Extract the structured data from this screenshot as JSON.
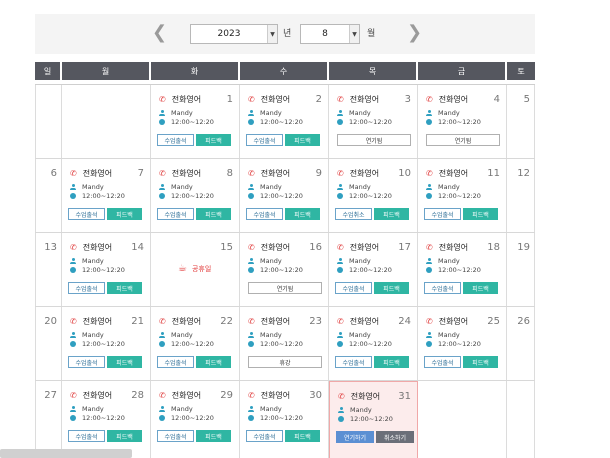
{
  "nav": {
    "year": "2023",
    "year_unit": "년",
    "month": "8",
    "month_unit": "월",
    "prev_icon": "chevron-left-icon",
    "next_icon": "chevron-right-icon"
  },
  "weekdays": [
    "일",
    "월",
    "화",
    "수",
    "목",
    "금",
    "토"
  ],
  "class": {
    "title": "전화영어",
    "user": "Mandy",
    "time": "12:00~12:20"
  },
  "labels": {
    "attend": "수업출석",
    "feedback": "피드백",
    "postponed": "연기됨",
    "postpone": "연기하기",
    "cancel": "취소하기",
    "cancel_done": "수업취소",
    "closed": "휴강",
    "holiday": "공휴일"
  },
  "colors": {
    "header": "#55575f",
    "teal": "#2fb6a3",
    "today_bg": "#fcecec",
    "phone": "#e04040",
    "holiday": "#e23b3b"
  },
  "weeks": [
    [
      {
        "day": "",
        "type": "empty"
      },
      {
        "day": "",
        "type": "empty"
      },
      {
        "day": "1",
        "type": "class",
        "action": "attend_feedback"
      },
      {
        "day": "2",
        "type": "class",
        "action": "attend_feedback"
      },
      {
        "day": "3",
        "type": "class",
        "action": "postponed"
      },
      {
        "day": "4",
        "type": "class",
        "action": "postponed"
      },
      {
        "day": "5",
        "type": "plain"
      }
    ],
    [
      {
        "day": "6",
        "type": "plain"
      },
      {
        "day": "7",
        "type": "class",
        "action": "attend_feedback"
      },
      {
        "day": "8",
        "type": "class",
        "action": "attend_feedback"
      },
      {
        "day": "9",
        "type": "class",
        "action": "attend_feedback"
      },
      {
        "day": "10",
        "type": "class",
        "action": "cancel_feedback"
      },
      {
        "day": "11",
        "type": "class",
        "action": "attend_feedback"
      },
      {
        "day": "12",
        "type": "plain"
      }
    ],
    [
      {
        "day": "13",
        "type": "plain"
      },
      {
        "day": "14",
        "type": "class",
        "action": "attend_feedback"
      },
      {
        "day": "15",
        "type": "holiday"
      },
      {
        "day": "16",
        "type": "class",
        "action": "postponed"
      },
      {
        "day": "17",
        "type": "class",
        "action": "attend_feedback"
      },
      {
        "day": "18",
        "type": "class",
        "action": "attend_feedback"
      },
      {
        "day": "19",
        "type": "plain"
      }
    ],
    [
      {
        "day": "20",
        "type": "plain"
      },
      {
        "day": "21",
        "type": "class",
        "action": "attend_feedback"
      },
      {
        "day": "22",
        "type": "class",
        "action": "attend_feedback"
      },
      {
        "day": "23",
        "type": "class",
        "action": "closed"
      },
      {
        "day": "24",
        "type": "class",
        "action": "attend_feedback"
      },
      {
        "day": "25",
        "type": "class",
        "action": "attend_feedback"
      },
      {
        "day": "26",
        "type": "plain"
      }
    ],
    [
      {
        "day": "27",
        "type": "plain"
      },
      {
        "day": "28",
        "type": "class",
        "action": "attend_feedback"
      },
      {
        "day": "29",
        "type": "class",
        "action": "attend_feedback"
      },
      {
        "day": "30",
        "type": "class",
        "action": "attend_feedback"
      },
      {
        "day": "31",
        "type": "class",
        "action": "postpone_cancel",
        "today": true
      },
      {
        "day": "",
        "type": "empty"
      },
      {
        "day": "",
        "type": "empty"
      }
    ]
  ]
}
